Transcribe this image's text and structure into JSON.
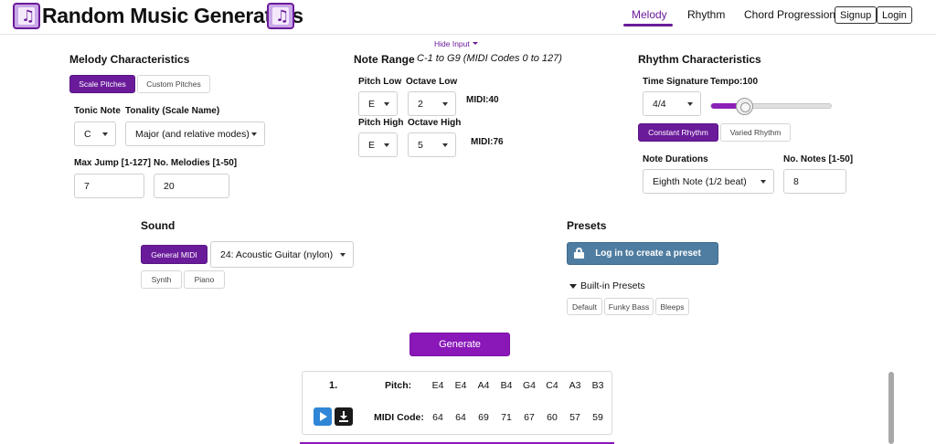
{
  "header": {
    "title": "Random Music Generators",
    "nav": [
      "Melody",
      "Rhythm",
      "Chord Progression"
    ],
    "active_nav": "Melody",
    "signup": "Signup",
    "login": "Login",
    "accent_color": "#6a1b9a"
  },
  "hide_input": "Hide Input",
  "melody": {
    "title": "Melody Characteristics",
    "scale_pitches": "Scale Pitches",
    "custom_pitches": "Custom Pitches",
    "tonic_label": "Tonic Note",
    "tonic_value": "C",
    "tonality_label": "Tonality (Scale Name)",
    "tonality_value": "Major (and relative modes)",
    "max_jump_label": "Max Jump [1-127]",
    "max_jump_value": "7",
    "num_melodies_label": "No. Melodies [1-50]",
    "num_melodies_value": "20"
  },
  "note_range": {
    "title": "Note Range",
    "subtitle": "C-1 to G9 (MIDI Codes 0 to 127)",
    "pitch_low_label": "Pitch Low",
    "pitch_low_value": "E",
    "octave_low_label": "Octave Low",
    "octave_low_value": "2",
    "midi_low": "MIDI:40",
    "pitch_high_label": "Pitch High",
    "pitch_high_value": "E",
    "octave_high_label": "Octave High",
    "octave_high_value": "5",
    "midi_high": "MIDI:76"
  },
  "rhythm": {
    "title": "Rhythm Characteristics",
    "time_sig_label": "Time Signature",
    "time_sig_value": "4/4",
    "tempo_label": "Tempo:100",
    "tempo_fraction": 0.28,
    "constant_rhythm": "Constant Rhythm",
    "varied_rhythm": "Varied Rhythm",
    "note_durations_label": "Note Durations",
    "note_durations_value": "Eighth Note (1/2 beat)",
    "num_notes_label": "No. Notes [1-50]",
    "num_notes_value": "8"
  },
  "sound": {
    "title": "Sound",
    "general_midi": "General MIDI",
    "instrument": "24: Acoustic Guitar (nylon)",
    "synth": "Synth",
    "piano": "Piano"
  },
  "presets": {
    "title": "Presets",
    "login_button": "Log in to create a preset",
    "builtin_label": "Built-in Presets",
    "items": [
      "Default",
      "Funky Bass",
      "Bleeps"
    ]
  },
  "generate": "Generate",
  "result": {
    "number": "1.",
    "pitch_label": "Pitch:",
    "midi_label": "MIDI Code:",
    "pitches": [
      "E4",
      "E4",
      "A4",
      "B4",
      "G4",
      "C4",
      "A3",
      "B3"
    ],
    "midi_codes": [
      "64",
      "64",
      "69",
      "71",
      "67",
      "60",
      "57",
      "59"
    ]
  }
}
